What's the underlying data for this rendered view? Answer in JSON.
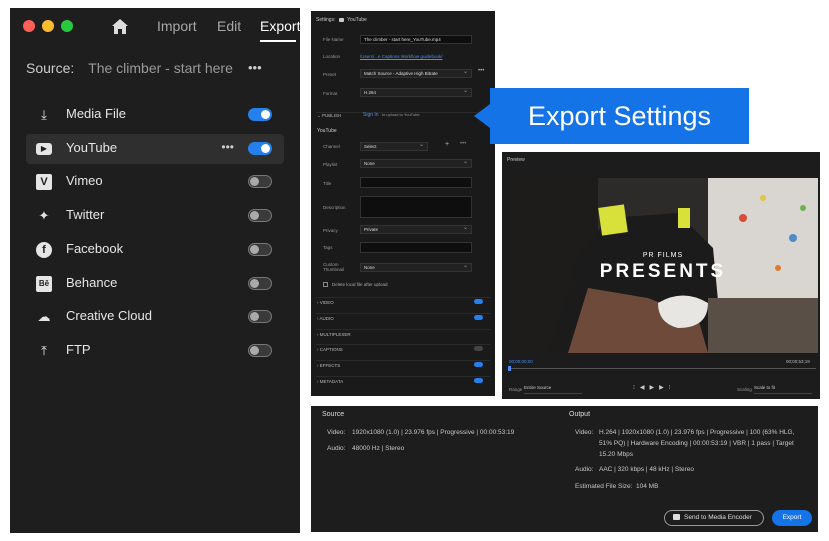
{
  "left_panel": {
    "tabs": {
      "import": "Import",
      "edit": "Edit",
      "export": "Export"
    },
    "source_label": "Source:",
    "source_value": "The climber - start here",
    "more": "•••",
    "destinations": [
      {
        "label": "Media File",
        "icon": "download-icon",
        "on": true
      },
      {
        "label": "YouTube",
        "icon": "youtube-icon",
        "on": true,
        "selected": true
      },
      {
        "label": "Vimeo",
        "icon": "vimeo-icon",
        "on": false
      },
      {
        "label": "Twitter",
        "icon": "twitter-icon",
        "on": false
      },
      {
        "label": "Facebook",
        "icon": "facebook-icon",
        "on": false
      },
      {
        "label": "Behance",
        "icon": "behance-icon",
        "on": false
      },
      {
        "label": "Creative Cloud",
        "icon": "creative-cloud-icon",
        "on": false
      },
      {
        "label": "FTP",
        "icon": "upload-icon",
        "on": false
      }
    ]
  },
  "settings": {
    "header_label": "Settings:",
    "header_value": "YouTube",
    "file_name_label": "File Name",
    "file_name_value": "The climber - start here_YouTube.mp4",
    "location_label": "Location",
    "location_value": "/Users/...e Captions Workflow guidebook/",
    "preset_label": "Preset",
    "preset_value": "Match Source - Adaptive High Bitrate",
    "format_label": "Format",
    "format_value": "H.264",
    "publish_label": "PUBLISH",
    "sign_in": "Sign In",
    "sign_in_suffix": "to upload to YouTube",
    "youtube_label": "YouTube",
    "channel_label": "Channel",
    "channel_value": "Select",
    "playlist_label": "Playlist",
    "playlist_value": "None",
    "title_label": "Title",
    "description_label": "Description",
    "privacy_label": "Privacy",
    "privacy_value": "Private",
    "tags_label": "Tags",
    "thumb_label_1": "Custom",
    "thumb_label_2": "Thumbnail",
    "thumb_value": "None",
    "delete_label": "Delete local file after upload",
    "sections": [
      {
        "label": "VIDEO",
        "on": true
      },
      {
        "label": "AUDIO",
        "on": true
      },
      {
        "label": "MULTIPLEXER",
        "on": null
      },
      {
        "label": "CAPTIONS",
        "on": false
      },
      {
        "label": "EFFECTS",
        "on": true
      },
      {
        "label": "METADATA",
        "on": true
      }
    ]
  },
  "callout": {
    "text": "Export Settings"
  },
  "preview": {
    "title": "Preview",
    "video_text_small": "PR FILMS",
    "video_text_big": "PRESENTS",
    "tc_start": "00;00;00;00",
    "tc_end": "00;00;53;19",
    "range_label": "Range",
    "range_value": "Entire Source",
    "scaling_label": "Scaling",
    "scaling_value": "Scale to fit"
  },
  "info": {
    "source_title": "Source",
    "src_video_label": "Video:",
    "src_video": "1920x1080 (1.0)  |  23.976 fps  |  Progressive  |  00:00:53:19",
    "src_audio_label": "Audio:",
    "src_audio": "48000 Hz  |  Stereo",
    "output_title": "Output",
    "out_video_label": "Video:",
    "out_video_1": "H.264  |  1920x1080 (1.0)  |  23.976 fps  |  Progressive  |  100 (63% HLG,",
    "out_video_2": "51% PQ)  |  Hardware Encoding  |  00:00:53:19  |  VBR  |  1 pass  |  Target",
    "out_video_3": "15.20 Mbps",
    "out_audio_label": "Audio:",
    "out_audio": "AAC  |  320 kbps  |  48 kHz  |  Stereo",
    "size_label": "Estimated File Size:",
    "size_value": "104 MB",
    "encoder_button": "Send to Media Encoder",
    "export_button": "Export"
  }
}
